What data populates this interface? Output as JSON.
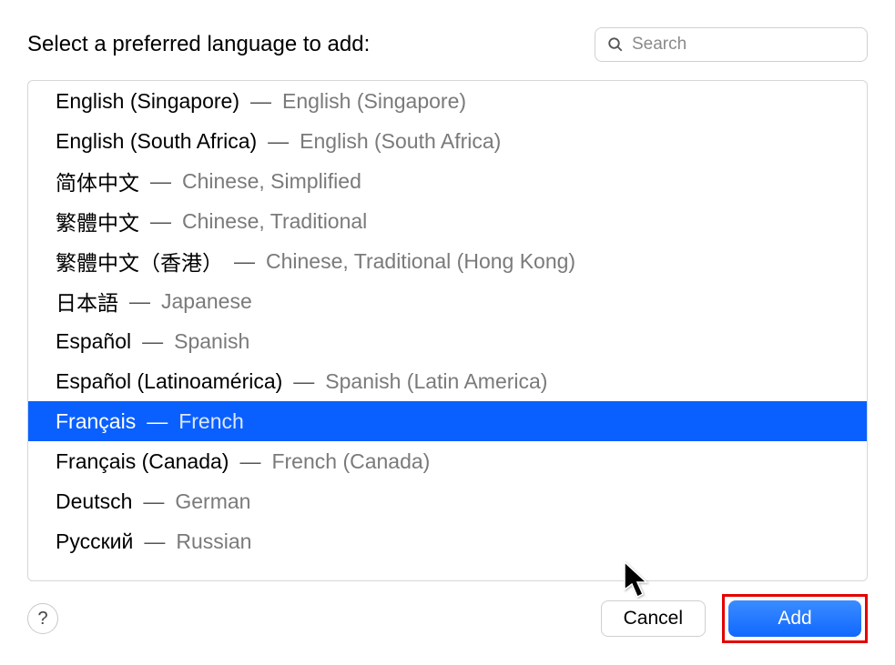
{
  "title": "Select a preferred language to add:",
  "search": {
    "placeholder": "Search",
    "value": ""
  },
  "languages": [
    {
      "native": "English (Singapore)",
      "english": "English (Singapore)",
      "selected": false
    },
    {
      "native": "English (South Africa)",
      "english": "English (South Africa)",
      "selected": false
    },
    {
      "native": "简体中文",
      "english": "Chinese, Simplified",
      "selected": false
    },
    {
      "native": "繁體中文",
      "english": "Chinese, Traditional",
      "selected": false
    },
    {
      "native": "繁體中文（香港）",
      "english": "Chinese, Traditional (Hong Kong)",
      "selected": false
    },
    {
      "native": "日本語",
      "english": "Japanese",
      "selected": false
    },
    {
      "native": "Español",
      "english": "Spanish",
      "selected": false
    },
    {
      "native": "Español (Latinoamérica)",
      "english": "Spanish (Latin America)",
      "selected": false
    },
    {
      "native": "Français",
      "english": "French",
      "selected": true
    },
    {
      "native": "Français (Canada)",
      "english": "French (Canada)",
      "selected": false
    },
    {
      "native": "Deutsch",
      "english": "German",
      "selected": false
    },
    {
      "native": "Русский",
      "english": "Russian",
      "selected": false
    }
  ],
  "separator": "—",
  "buttons": {
    "cancel": "Cancel",
    "add": "Add",
    "help": "?"
  }
}
